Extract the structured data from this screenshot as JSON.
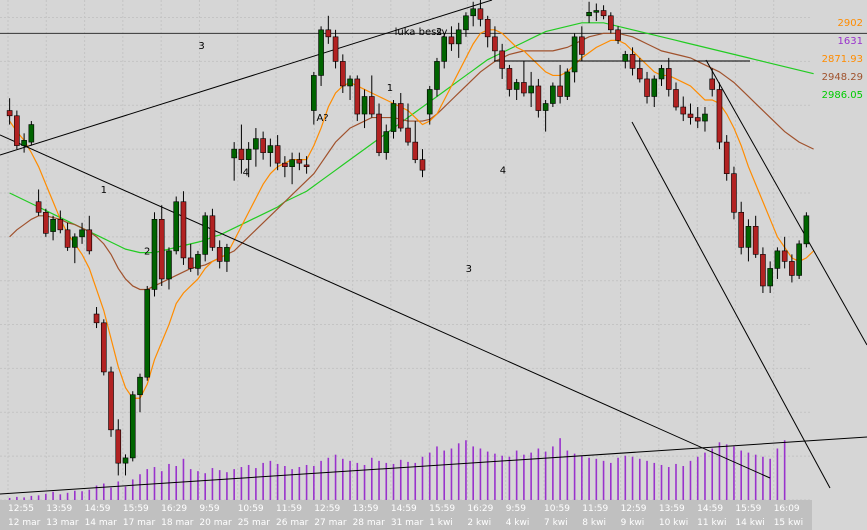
{
  "chart_data": {
    "type": "candlestick",
    "grid": true,
    "legend_position": "top-right",
    "ylim": [
      2720,
      3005
    ],
    "volume_max": 1650,
    "legend": [
      {
        "text": "2902",
        "color": "#ff8c00"
      },
      {
        "text": "1631",
        "color": "#9932cc"
      },
      {
        "text": "2871.93",
        "color": "#ff8c00"
      },
      {
        "text": "2948.29",
        "color": "#a0522d"
      },
      {
        "text": "2986.05",
        "color": "#00cc00"
      }
    ],
    "x_tick_labels": [
      {
        "time": "12:55",
        "date": "12 mar"
      },
      {
        "time": "13:59",
        "date": "13 mar"
      },
      {
        "time": "14:59",
        "date": "14 mar"
      },
      {
        "time": "15:59",
        "date": "17 mar"
      },
      {
        "time": "16:29",
        "date": "18 mar"
      },
      {
        "time": "9:59",
        "date": "20 mar"
      },
      {
        "time": "10:59",
        "date": "25 mar"
      },
      {
        "time": "11:59",
        "date": "26 mar"
      },
      {
        "time": "12:59",
        "date": "27 mar"
      },
      {
        "time": "13:59",
        "date": "28 mar"
      },
      {
        "time": "14:59",
        "date": "31 mar"
      },
      {
        "time": "15:59",
        "date": "1 kwi"
      },
      {
        "time": "16:29",
        "date": "2 kwi"
      },
      {
        "time": "9:59",
        "date": "4 kwi"
      },
      {
        "time": "10:59",
        "date": "7 kwi"
      },
      {
        "time": "11:59",
        "date": "8 kwi"
      },
      {
        "time": "12:59",
        "date": "9 kwi"
      },
      {
        "time": "13:59",
        "date": "10 kwi"
      },
      {
        "time": "14:59",
        "date": "11 kwi"
      },
      {
        "time": "15:59",
        "date": "14 kwi"
      },
      {
        "time": "16:09",
        "date": "15 kwi"
      }
    ],
    "horizontal_lines": [
      2986
    ],
    "annotations": [
      {
        "text": "1",
        "x": 13,
        "y": 2895
      },
      {
        "text": "2",
        "x": 19,
        "y": 2860
      },
      {
        "text": "3",
        "x": 26.5,
        "y": 2977
      },
      {
        "text": "4",
        "x": 32.6,
        "y": 2905
      },
      {
        "text": "A?",
        "x": 43.2,
        "y": 2936
      },
      {
        "text": "luka bessy",
        "x": 56.8,
        "y": 2985
      },
      {
        "text": "2",
        "x": 59.3,
        "y": 2985
      },
      {
        "text": "1",
        "x": 52.5,
        "y": 2953
      },
      {
        "text": "3",
        "x": 63.4,
        "y": 2850
      },
      {
        "text": "4",
        "x": 68.1,
        "y": 2906
      }
    ],
    "candles": [
      [
        2942,
        2949,
        2934,
        2939
      ],
      [
        2939,
        2942,
        2920,
        2922
      ],
      [
        2922,
        2929,
        2918,
        2925
      ],
      [
        2924,
        2936,
        2922,
        2934
      ],
      [
        2890,
        2897,
        2882,
        2884
      ],
      [
        2884,
        2886,
        2870,
        2872
      ],
      [
        2873,
        2882,
        2868,
        2880
      ],
      [
        2880,
        2885,
        2872,
        2874
      ],
      [
        2874,
        2878,
        2862,
        2864
      ],
      [
        2864,
        2872,
        2855,
        2870
      ],
      [
        2870,
        2878,
        2866,
        2874
      ],
      [
        2874,
        2882,
        2860,
        2862
      ],
      [
        2826,
        2830,
        2818,
        2821
      ],
      [
        2821,
        2823,
        2791,
        2793
      ],
      [
        2793,
        2796,
        2756,
        2760
      ],
      [
        2760,
        2766,
        2734,
        2741
      ],
      [
        2741,
        2746,
        2734,
        2744
      ],
      [
        2744,
        2782,
        2742,
        2780
      ],
      [
        2780,
        2792,
        2770,
        2790
      ],
      [
        2790,
        2842,
        2788,
        2840
      ],
      [
        2840,
        2884,
        2836,
        2880
      ],
      [
        2880,
        2888,
        2842,
        2846
      ],
      [
        2846,
        2864,
        2840,
        2862
      ],
      [
        2862,
        2893,
        2860,
        2890
      ],
      [
        2890,
        2896,
        2854,
        2858
      ],
      [
        2858,
        2866,
        2850,
        2852
      ],
      [
        2852,
        2862,
        2848,
        2860
      ],
      [
        2860,
        2884,
        2856,
        2882
      ],
      [
        2882,
        2886,
        2862,
        2864
      ],
      [
        2864,
        2868,
        2852,
        2856
      ],
      [
        2856,
        2866,
        2850,
        2864
      ],
      [
        2915,
        2924,
        2902,
        2920
      ],
      [
        2920,
        2934,
        2906,
        2914
      ],
      [
        2914,
        2924,
        2904,
        2920
      ],
      [
        2920,
        2932,
        2910,
        2926
      ],
      [
        2926,
        2930,
        2914,
        2918
      ],
      [
        2918,
        2926,
        2910,
        2922
      ],
      [
        2922,
        2928,
        2908,
        2912
      ],
      [
        2912,
        2916,
        2904,
        2910
      ],
      [
        2910,
        2918,
        2900,
        2914
      ],
      [
        2914,
        2918,
        2908,
        2912
      ],
      [
        2911,
        2916,
        2906,
        2910
      ],
      [
        2942,
        2964,
        2934,
        2962
      ],
      [
        2962,
        2990,
        2956,
        2988
      ],
      [
        2988,
        2996,
        2980,
        2984
      ],
      [
        2984,
        2988,
        2966,
        2970
      ],
      [
        2970,
        2974,
        2952,
        2956
      ],
      [
        2956,
        2962,
        2948,
        2960
      ],
      [
        2960,
        2962,
        2936,
        2940
      ],
      [
        2940,
        2954,
        2932,
        2950
      ],
      [
        2950,
        2962,
        2938,
        2940
      ],
      [
        2940,
        2946,
        2916,
        2918
      ],
      [
        2918,
        2934,
        2914,
        2930
      ],
      [
        2930,
        2948,
        2926,
        2946
      ],
      [
        2946,
        2952,
        2930,
        2932
      ],
      [
        2932,
        2946,
        2922,
        2924
      ],
      [
        2924,
        2936,
        2912,
        2914
      ],
      [
        2914,
        2920,
        2904,
        2908
      ],
      [
        2940,
        2956,
        2934,
        2954
      ],
      [
        2954,
        2972,
        2950,
        2970
      ],
      [
        2970,
        2986,
        2966,
        2984
      ],
      [
        2984,
        2990,
        2976,
        2980
      ],
      [
        2980,
        2992,
        2972,
        2988
      ],
      [
        2988,
        2998,
        2984,
        2996
      ],
      [
        2996,
        3004,
        2990,
        3000
      ],
      [
        3000,
        3008,
        2990,
        2994
      ],
      [
        2994,
        2996,
        2978,
        2984
      ],
      [
        2984,
        2990,
        2970,
        2976
      ],
      [
        2976,
        2980,
        2960,
        2966
      ],
      [
        2966,
        2968,
        2950,
        2954
      ],
      [
        2954,
        2960,
        2948,
        2958
      ],
      [
        2958,
        2970,
        2950,
        2952
      ],
      [
        2952,
        2964,
        2944,
        2956
      ],
      [
        2956,
        2960,
        2938,
        2942
      ],
      [
        2942,
        2948,
        2930,
        2946
      ],
      [
        2946,
        2958,
        2944,
        2956
      ],
      [
        2956,
        2968,
        2946,
        2950
      ],
      [
        2950,
        2966,
        2948,
        2964
      ],
      [
        2964,
        2986,
        2958,
        2984
      ],
      [
        2984,
        2990,
        2970,
        2974
      ],
      [
        2996,
        3004,
        2992,
        2998
      ],
      [
        2998,
        3003,
        2993,
        2999
      ],
      [
        2999,
        3002,
        2994,
        2996
      ],
      [
        2996,
        2998,
        2986,
        2988
      ],
      [
        2988,
        2990,
        2980,
        2982
      ],
      [
        2970,
        2976,
        2966,
        2974
      ],
      [
        2974,
        2978,
        2962,
        2966
      ],
      [
        2966,
        2972,
        2958,
        2960
      ],
      [
        2960,
        2964,
        2946,
        2950
      ],
      [
        2950,
        2962,
        2944,
        2960
      ],
      [
        2960,
        2968,
        2956,
        2966
      ],
      [
        2966,
        2972,
        2950,
        2954
      ],
      [
        2954,
        2958,
        2942,
        2944
      ],
      [
        2944,
        2950,
        2936,
        2940
      ],
      [
        2940,
        2946,
        2934,
        2938
      ],
      [
        2938,
        2944,
        2932,
        2936
      ],
      [
        2936,
        2944,
        2930,
        2940
      ],
      [
        2960,
        2966,
        2950,
        2954
      ],
      [
        2954,
        2958,
        2920,
        2924
      ],
      [
        2924,
        2928,
        2902,
        2906
      ],
      [
        2906,
        2910,
        2880,
        2884
      ],
      [
        2884,
        2890,
        2860,
        2864
      ],
      [
        2864,
        2880,
        2856,
        2876
      ],
      [
        2876,
        2882,
        2858,
        2860
      ],
      [
        2860,
        2864,
        2838,
        2842
      ],
      [
        2842,
        2856,
        2838,
        2852
      ],
      [
        2852,
        2864,
        2846,
        2862
      ],
      [
        2862,
        2870,
        2852,
        2856
      ],
      [
        2856,
        2860,
        2844,
        2848
      ],
      [
        2848,
        2868,
        2846,
        2866
      ],
      [
        2866,
        2884,
        2864,
        2882
      ]
    ],
    "volume": [
      20,
      30,
      25,
      40,
      45,
      60,
      80,
      55,
      70,
      90,
      85,
      100,
      140,
      160,
      120,
      180,
      130,
      200,
      250,
      300,
      320,
      280,
      350,
      330,
      400,
      300,
      280,
      260,
      310,
      290,
      270,
      300,
      320,
      340,
      310,
      360,
      380,
      350,
      330,
      300,
      320,
      340,
      330,
      380,
      410,
      440,
      400,
      380,
      360,
      340,
      410,
      380,
      360,
      350,
      390,
      370,
      360,
      420,
      460,
      520,
      480,
      500,
      550,
      580,
      520,
      500,
      470,
      450,
      430,
      420,
      480,
      440,
      460,
      500,
      470,
      520,
      600,
      480,
      450,
      430,
      410,
      400,
      380,
      360,
      410,
      430,
      420,
      400,
      380,
      360,
      340,
      320,
      350,
      330,
      380,
      420,
      460,
      500,
      560,
      540,
      520,
      480,
      460,
      440,
      420,
      400,
      500,
      580
    ],
    "ema_orange": [
      2936,
      2930,
      2925,
      2918,
      2910,
      2900,
      2890,
      2880,
      2872,
      2866,
      2860,
      2852,
      2840,
      2828,
      2812,
      2796,
      2784,
      2778,
      2778,
      2786,
      2800,
      2810,
      2820,
      2832,
      2838,
      2842,
      2846,
      2852,
      2856,
      2858,
      2860,
      2868,
      2876,
      2884,
      2892,
      2900,
      2906,
      2910,
      2912,
      2914,
      2914,
      2914,
      2922,
      2932,
      2944,
      2952,
      2956,
      2958,
      2956,
      2954,
      2952,
      2950,
      2948,
      2946,
      2944,
      2942,
      2938,
      2934,
      2936,
      2940,
      2948,
      2956,
      2964,
      2972,
      2980,
      2986,
      2988,
      2988,
      2986,
      2982,
      2978,
      2976,
      2972,
      2968,
      2964,
      2962,
      2962,
      2964,
      2968,
      2972,
      2975,
      2978,
      2980,
      2982,
      2982,
      2980,
      2976,
      2972,
      2968,
      2964,
      2962,
      2962,
      2960,
      2958,
      2956,
      2952,
      2948,
      2948,
      2946,
      2940,
      2932,
      2922,
      2910,
      2900,
      2890,
      2880,
      2870,
      2864,
      2858,
      2856,
      2858,
      2862
    ],
    "ema_brown": [
      2870,
      2874,
      2877,
      2880,
      2882,
      2882,
      2881,
      2880,
      2878,
      2877,
      2875,
      2873,
      2870,
      2866,
      2860,
      2852,
      2846,
      2842,
      2840,
      2840,
      2842,
      2844,
      2846,
      2848,
      2850,
      2852,
      2853,
      2854,
      2856,
      2858,
      2860,
      2862,
      2866,
      2870,
      2874,
      2878,
      2882,
      2886,
      2890,
      2894,
      2898,
      2902,
      2906,
      2912,
      2918,
      2924,
      2928,
      2932,
      2934,
      2936,
      2938,
      2938,
      2938,
      2938,
      2937,
      2936,
      2936,
      2936,
      2937,
      2940,
      2944,
      2948,
      2952,
      2956,
      2960,
      2964,
      2967,
      2970,
      2972,
      2974,
      2975,
      2976,
      2976,
      2976,
      2976,
      2976,
      2977,
      2978,
      2980,
      2982,
      2984,
      2985,
      2986,
      2986,
      2986,
      2985,
      2984,
      2982,
      2980,
      2978,
      2976,
      2975,
      2974,
      2973,
      2972,
      2970,
      2968,
      2966,
      2964,
      2961,
      2958,
      2954,
      2950,
      2946,
      2942,
      2938,
      2934,
      2930,
      2927,
      2924,
      2922,
      2920
    ],
    "ema_green": [
      2895,
      2893,
      2891,
      2889,
      2887,
      2885,
      2883,
      2881,
      2879,
      2877,
      2875,
      2873,
      2871,
      2869,
      2867,
      2865,
      2863,
      2862,
      2861,
      2861,
      2861,
      2862,
      2863,
      2864,
      2865,
      2866,
      2867,
      2868,
      2870,
      2871,
      2873,
      2875,
      2877,
      2879,
      2881,
      2883,
      2885,
      2887,
      2890,
      2892,
      2894,
      2896,
      2899,
      2902,
      2905,
      2908,
      2911,
      2914,
      2917,
      2920,
      2923,
      2926,
      2929,
      2932,
      2935,
      2938,
      2941,
      2944,
      2947,
      2950,
      2953,
      2956,
      2959,
      2962,
      2965,
      2968,
      2971,
      2973,
      2975,
      2977,
      2979,
      2981,
      2983,
      2985,
      2987,
      2988,
      2989,
      2990,
      2991,
      2992,
      2992,
      2992,
      2992,
      2991,
      2990,
      2989,
      2988,
      2987,
      2986,
      2985,
      2984,
      2983,
      2982,
      2981,
      2980,
      2979,
      2978,
      2977,
      2976,
      2975,
      2974,
      2973,
      2972,
      2971,
      2970,
      2969,
      2968,
      2967,
      2966,
      2965,
      2964,
      2963
    ]
  }
}
